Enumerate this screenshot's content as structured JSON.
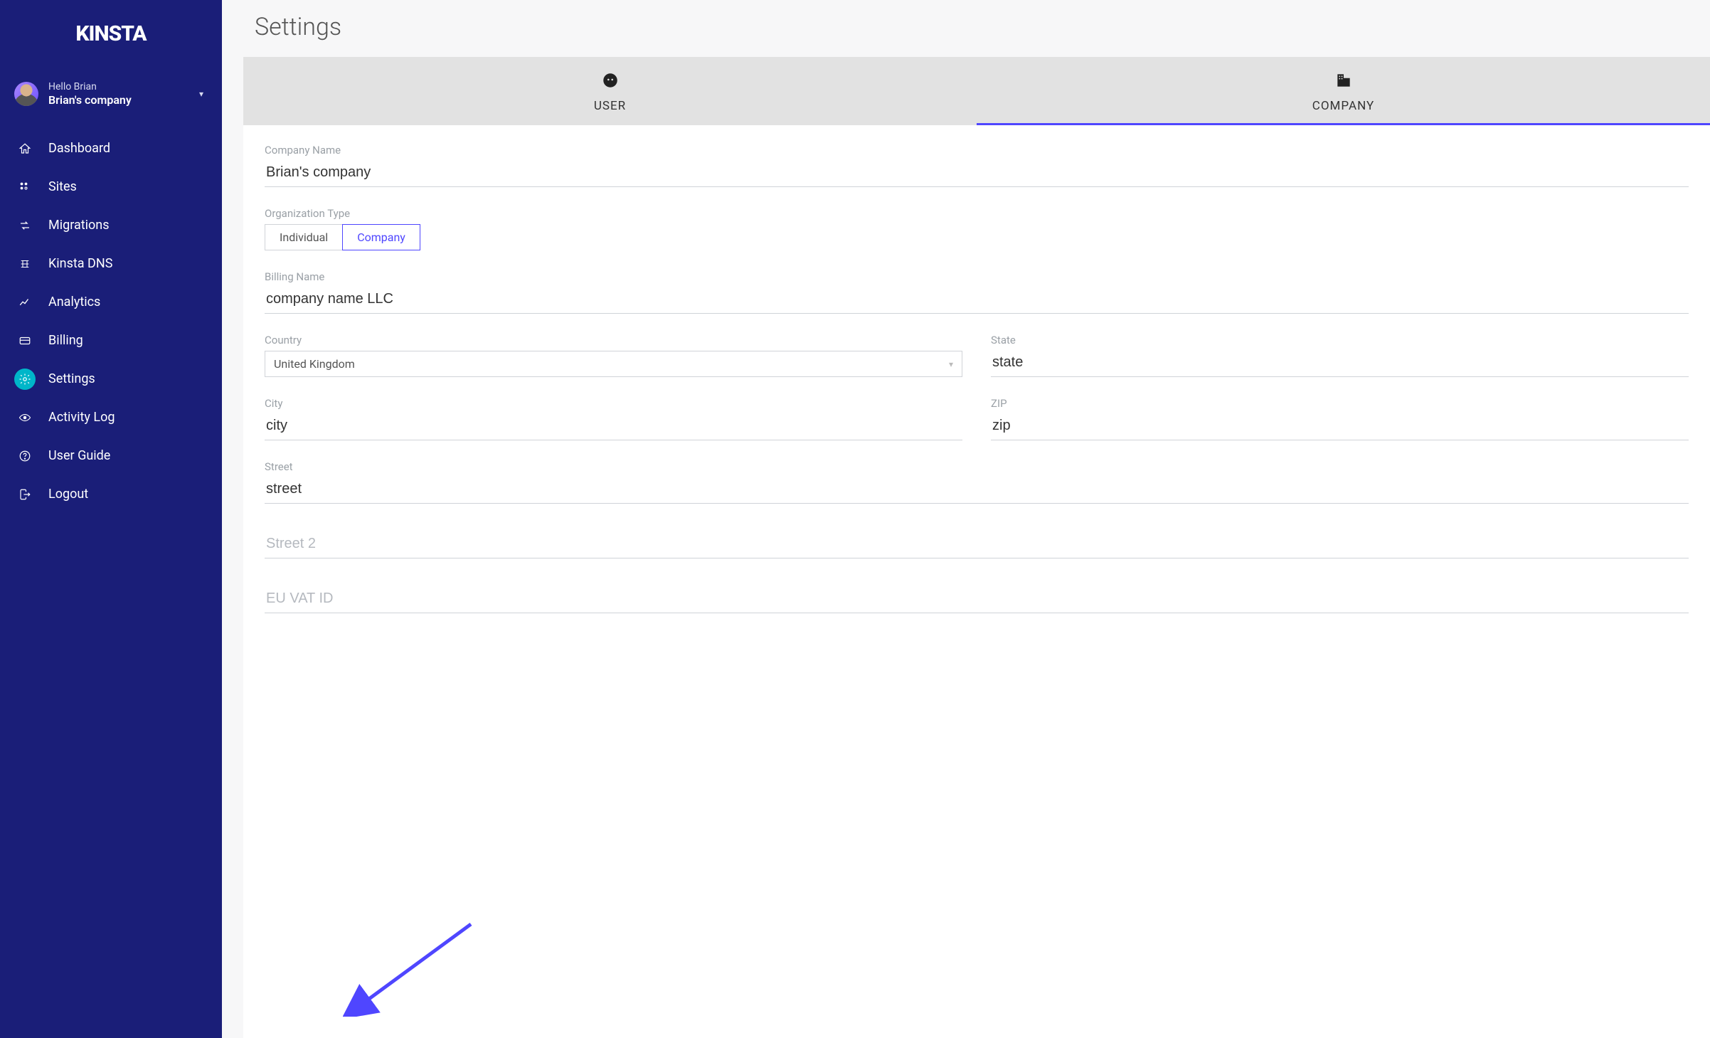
{
  "brand": "KINSTA",
  "user": {
    "hello": "Hello Brian",
    "company": "Brian's company"
  },
  "nav": {
    "dashboard": "Dashboard",
    "sites": "Sites",
    "migrations": "Migrations",
    "dns": "Kinsta DNS",
    "analytics": "Analytics",
    "billing": "Billing",
    "settings": "Settings",
    "activity": "Activity Log",
    "guide": "User Guide",
    "logout": "Logout"
  },
  "page": {
    "title": "Settings"
  },
  "tabs": {
    "user": "USER",
    "company": "COMPANY"
  },
  "form": {
    "company_name": {
      "label": "Company Name",
      "value": "Brian's company"
    },
    "org_type": {
      "label": "Organization Type",
      "individual": "Individual",
      "company": "Company"
    },
    "billing_name": {
      "label": "Billing Name",
      "value": "company name LLC"
    },
    "country": {
      "label": "Country",
      "value": "United Kingdom"
    },
    "state": {
      "label": "State",
      "value": "state"
    },
    "city": {
      "label": "City",
      "value": "city"
    },
    "zip": {
      "label": "ZIP",
      "value": "zip"
    },
    "street": {
      "label": "Street",
      "value": "street"
    },
    "street2": {
      "placeholder": "Street 2"
    },
    "vat": {
      "placeholder": "EU VAT ID"
    }
  }
}
